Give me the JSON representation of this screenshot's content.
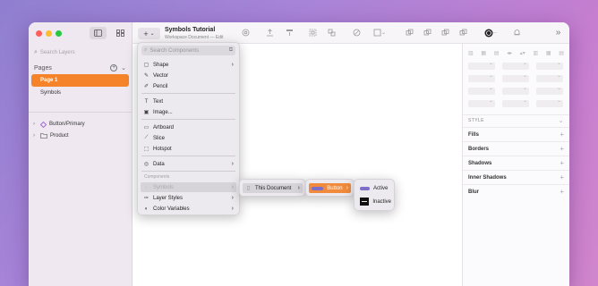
{
  "window": {
    "title": "Symbols Tutorial",
    "subtitle_doc": "Workspace Document",
    "subtitle_sep": "—",
    "subtitle_action": "Edit"
  },
  "colors": {
    "accent": "#f4832a",
    "traffic_red": "#fe5f57",
    "traffic_yellow": "#febc2e",
    "traffic_green": "#28c840",
    "symbol_purple": "#a66bd6"
  },
  "sidebar": {
    "search_placeholder": "Search Layers",
    "pages_label": "Pages",
    "pages": [
      {
        "label": "Page 1",
        "selected": true
      },
      {
        "label": "Symbols",
        "selected": false
      }
    ],
    "layers": [
      {
        "label": "Button/Primary",
        "icon": "symbol-diamond-icon"
      },
      {
        "label": "Product",
        "icon": "folder-icon"
      }
    ]
  },
  "toolbar": {
    "insert_label": "+",
    "icons": [
      "create-symbol-icon",
      "forward-icon",
      "backward-icon",
      "group-icon",
      "ungroup-icon",
      "edit-icon",
      "transform-icon",
      "boolean-union-icon",
      "boolean-subtract-icon",
      "boolean-intersect-icon",
      "boolean-difference-icon",
      "collaborate-icon",
      "notifications-icon",
      "sidebar-toggle-icon"
    ]
  },
  "insert_menu": {
    "search_placeholder": "Search Components",
    "items": [
      {
        "label": "Shape",
        "icon": "shape-icon",
        "submenu": true
      },
      {
        "label": "Vector",
        "icon": "vector-icon",
        "submenu": false
      },
      {
        "label": "Pencil",
        "icon": "pencil-icon",
        "submenu": false
      },
      {
        "label": "Text",
        "icon": "text-icon",
        "submenu": false
      },
      {
        "label": "Image...",
        "icon": "image-icon",
        "submenu": false
      },
      {
        "label": "Artboard",
        "icon": "artboard-icon",
        "submenu": false
      },
      {
        "label": "Slice",
        "icon": "slice-icon",
        "submenu": false
      },
      {
        "label": "Hotspot",
        "icon": "hotspot-icon",
        "submenu": false
      },
      {
        "label": "Data",
        "icon": "data-icon",
        "submenu": true
      }
    ],
    "components_header": "Components",
    "component_items": [
      {
        "label": "Symbols",
        "icon": "symbols-icon",
        "submenu": true,
        "disabled": true
      },
      {
        "label": "Layer Styles",
        "icon": "layer-styles-icon",
        "submenu": true
      },
      {
        "label": "Color Variables",
        "icon": "color-variables-icon",
        "submenu": true
      }
    ]
  },
  "symbols_submenu": {
    "items": [
      {
        "label": "This Document",
        "submenu": true
      }
    ]
  },
  "document_submenu": {
    "items": [
      {
        "label": "Button",
        "submenu": true
      }
    ]
  },
  "button_submenu": {
    "items": [
      {
        "label": "Active"
      },
      {
        "label": "Inactive"
      }
    ]
  },
  "inspector": {
    "style_header": "STYLE",
    "sections": [
      {
        "label": "Fills"
      },
      {
        "label": "Borders"
      },
      {
        "label": "Shadows"
      },
      {
        "label": "Inner Shadows"
      },
      {
        "label": "Blur"
      }
    ],
    "add_label": "+"
  }
}
